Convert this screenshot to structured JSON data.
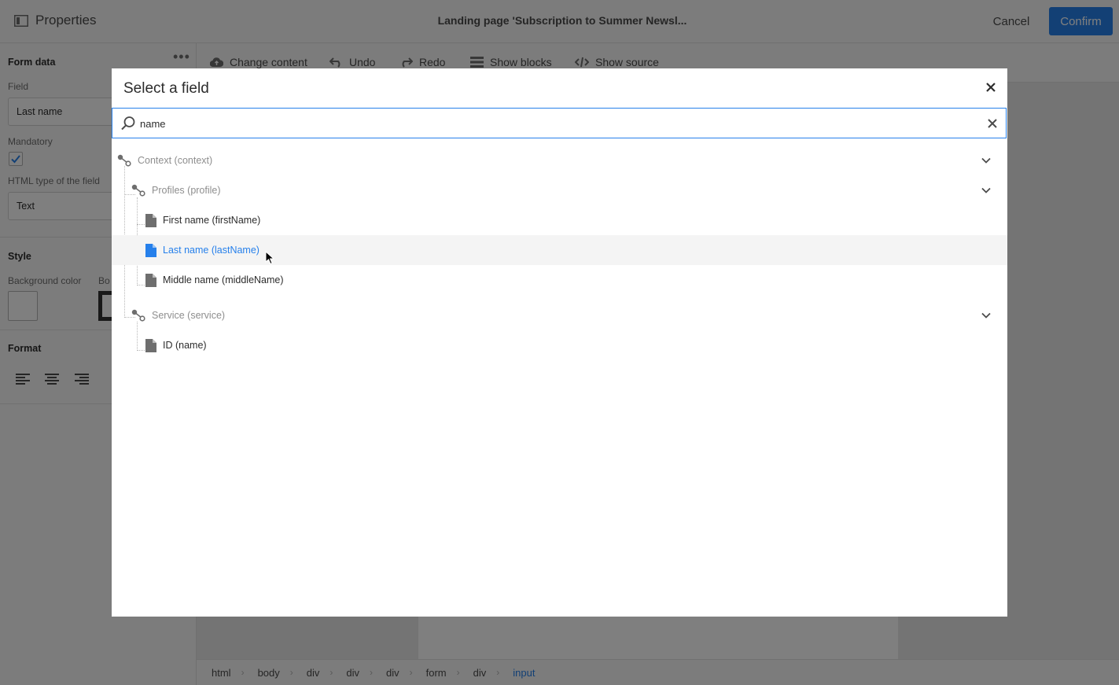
{
  "header": {
    "properties_label": "Properties",
    "title": "Landing page 'Subscription to Summer Newsl...",
    "cancel_label": "Cancel",
    "confirm_label": "Confirm"
  },
  "panel": {
    "form_data_title": "Form data",
    "field_label": "Field",
    "field_value": "Last name",
    "mandatory_label": "Mandatory",
    "mandatory_checked": true,
    "html_type_label": "HTML type of the field",
    "html_type_value": "Text",
    "style_title": "Style",
    "bg_color_label": "Background color",
    "border_label": "Bo",
    "format_title": "Format"
  },
  "toolbar": {
    "change_content": "Change content",
    "undo": "Undo",
    "redo": "Redo",
    "show_blocks": "Show blocks",
    "show_source": "Show source"
  },
  "breadcrumb": [
    "html",
    "body",
    "div",
    "div",
    "div",
    "form",
    "div",
    "input"
  ],
  "modal": {
    "title": "Select a field",
    "search_value": "name",
    "tree": {
      "context": "Context (context)",
      "profiles": "Profiles (profile)",
      "first_name": "First name (firstName)",
      "last_name": "Last name (lastName)",
      "middle_name": "Middle name (middleName)",
      "service": "Service (service)",
      "id_name": "ID (name)"
    },
    "selected_item": "Last name (lastName)"
  },
  "colors": {
    "accent": "#2680eb",
    "overlay": "rgba(0,0,0,0.5)"
  }
}
